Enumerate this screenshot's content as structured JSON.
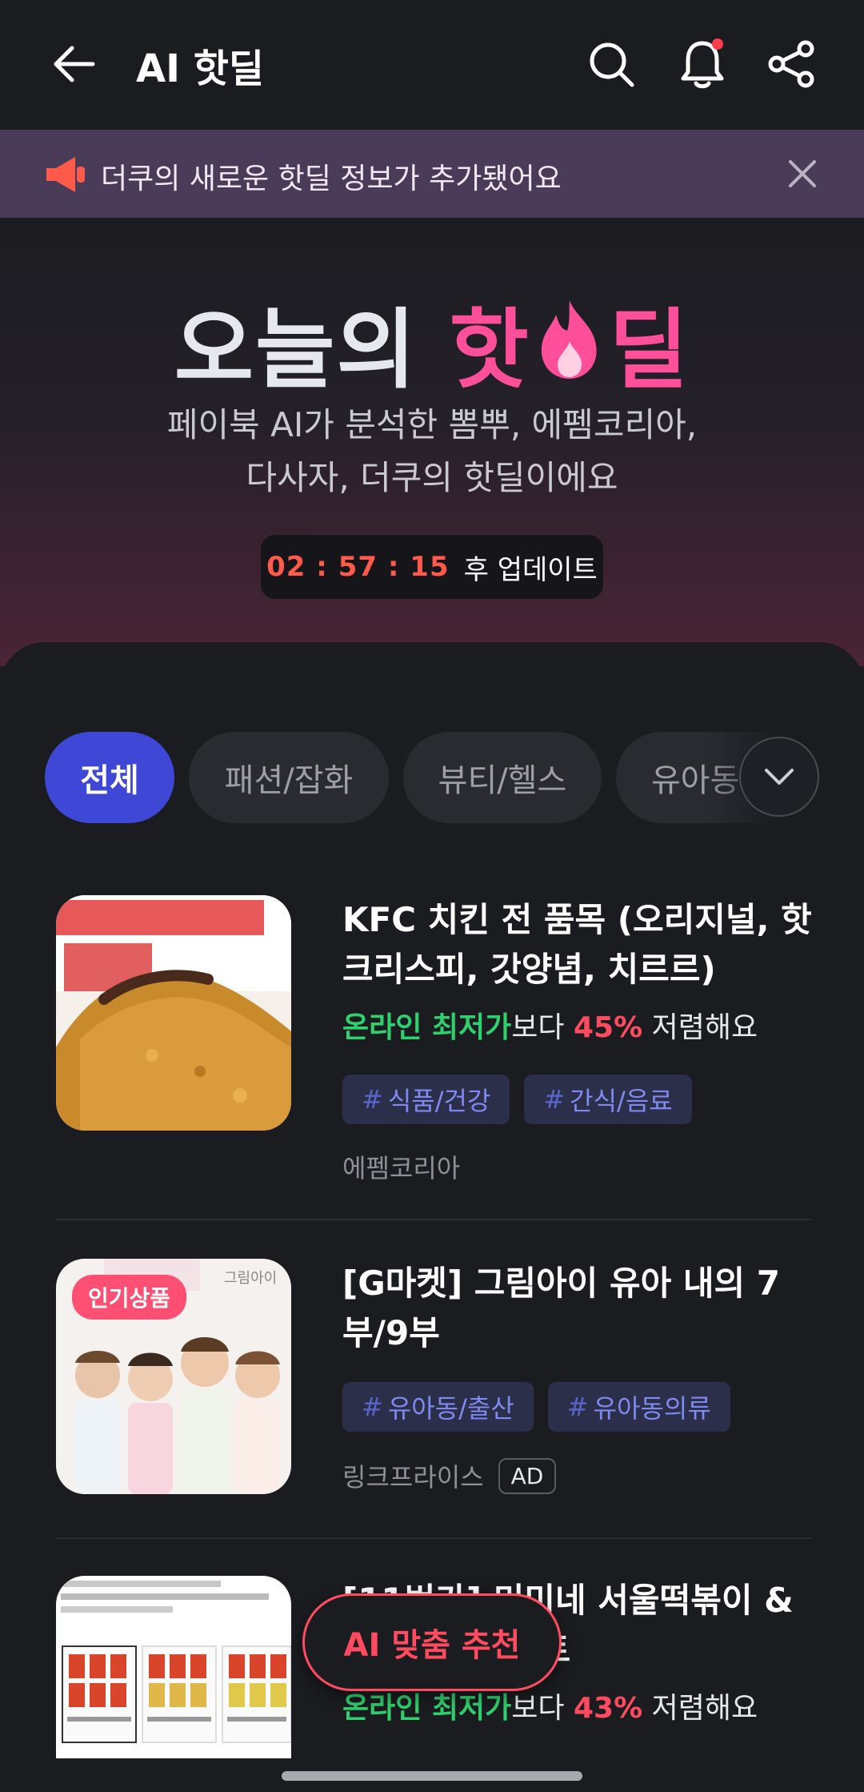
{
  "header": {
    "title": "AI 핫딜"
  },
  "notice": {
    "text": "더쿠의 새로운 핫딜 정보가 추가됐어요"
  },
  "hero": {
    "title_part1": "오늘의",
    "title_part2": "핫",
    "title_part3": "딜",
    "subtitle_line1": "페이북 AI가 분석한 뽐뿌, 에펨코리아,",
    "subtitle_line2": "다사자, 더쿠의 핫딜이에요",
    "timer": "02 : 57 : 15",
    "timer_suffix": "후 업데이트"
  },
  "tabs": [
    {
      "label": "전체",
      "active": true
    },
    {
      "label": "패션/잡화",
      "active": false
    },
    {
      "label": "뷰티/헬스",
      "active": false
    },
    {
      "label": "유아동",
      "active": false
    }
  ],
  "deals": [
    {
      "title": "KFC 치킨 전 품목 (오리지널, 핫크리스피, 갓양념, 치르르)",
      "price_lowest": "온라인 최저가",
      "price_mid": "보다",
      "price_pct": "45%",
      "price_suffix": "저렴해요",
      "tags": [
        "식품/건강",
        "간식/음료"
      ],
      "seller": "에펨코리아"
    },
    {
      "title": "[G마켓] 그림아이 유아 내의 7부/9부",
      "badge": "인기상품",
      "tags": [
        "유아동/출산",
        "유아동의류"
      ],
      "seller": "링크프라이스",
      "ad": "AD"
    },
    {
      "title": "[11번가] 미미네 서울떡볶이 & 부산떡볶이 세트",
      "price_lowest": "온라인 최저가",
      "price_mid": "보다",
      "price_pct": "43%",
      "price_suffix": "저렴해요"
    }
  ],
  "floating": {
    "ai_button": "AI 맞춤 추천"
  },
  "colors": {
    "accent_blue": "#3e47d6",
    "accent_pink": "#ff4f9a",
    "price_green": "#2fd06e",
    "price_red": "#ff4b5f"
  }
}
